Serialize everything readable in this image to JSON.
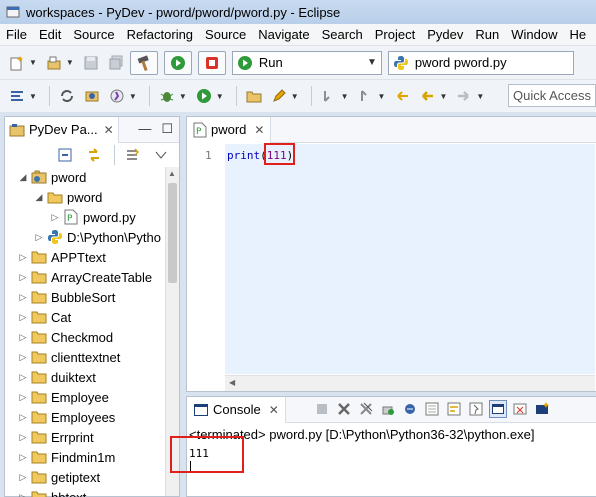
{
  "window": {
    "title": "workspaces - PyDev - pword/pword/pword.py - Eclipse"
  },
  "menu": [
    "File",
    "Edit",
    "Source",
    "Refactoring",
    "Source",
    "Navigate",
    "Search",
    "Project",
    "Pydev",
    "Run",
    "Window",
    "He"
  ],
  "toolbar": {
    "run_config": "Run",
    "file_combo": "pword pword.py",
    "quick_access": "Quick Access"
  },
  "explorer": {
    "tab_label": "PyDev Pa...",
    "tree": [
      {
        "label": "pword",
        "level": 0,
        "expanded": true,
        "icon": "python-project-icon"
      },
      {
        "label": "pword",
        "level": 1,
        "expanded": true,
        "icon": "package-folder-icon"
      },
      {
        "label": "pword.py",
        "level": 2,
        "expanded": false,
        "icon": "python-file-icon"
      },
      {
        "label": "D:\\Python\\Pytho",
        "level": 1,
        "expanded": false,
        "icon": "python-interpreter-icon"
      },
      {
        "label": "APPTtext",
        "level": 0,
        "expanded": false,
        "icon": "folder-icon"
      },
      {
        "label": "ArrayCreateTable",
        "level": 0,
        "expanded": false,
        "icon": "folder-icon"
      },
      {
        "label": "BubbleSort",
        "level": 0,
        "expanded": false,
        "icon": "folder-icon"
      },
      {
        "label": "Cat",
        "level": 0,
        "expanded": false,
        "icon": "folder-icon"
      },
      {
        "label": "Checkmod",
        "level": 0,
        "expanded": false,
        "icon": "folder-icon"
      },
      {
        "label": "clienttextnet",
        "level": 0,
        "expanded": false,
        "icon": "folder-icon"
      },
      {
        "label": "duiktext",
        "level": 0,
        "expanded": false,
        "icon": "folder-icon"
      },
      {
        "label": "Employee",
        "level": 0,
        "expanded": false,
        "icon": "folder-icon"
      },
      {
        "label": "Employees",
        "level": 0,
        "expanded": false,
        "icon": "folder-icon"
      },
      {
        "label": "Errprint",
        "level": 0,
        "expanded": false,
        "icon": "folder-icon"
      },
      {
        "label": "Findmin1m",
        "level": 0,
        "expanded": false,
        "icon": "folder-icon"
      },
      {
        "label": "getiptext",
        "level": 0,
        "expanded": false,
        "icon": "folder-icon"
      },
      {
        "label": "hbtext",
        "level": 0,
        "expanded": false,
        "icon": "folder-icon"
      }
    ]
  },
  "editor": {
    "tab_label": "pword",
    "line_number": "1",
    "code": {
      "func": "print",
      "open": "(",
      "arg": "111",
      "close": ")"
    }
  },
  "console": {
    "tab_label": "Console",
    "status": "<terminated> pword.py [D:\\Python\\Python36-32\\python.exe]",
    "output": "111"
  },
  "colors": {
    "highlight_box": "#e0201b",
    "editor_line_bg": "#e8f2fe"
  }
}
